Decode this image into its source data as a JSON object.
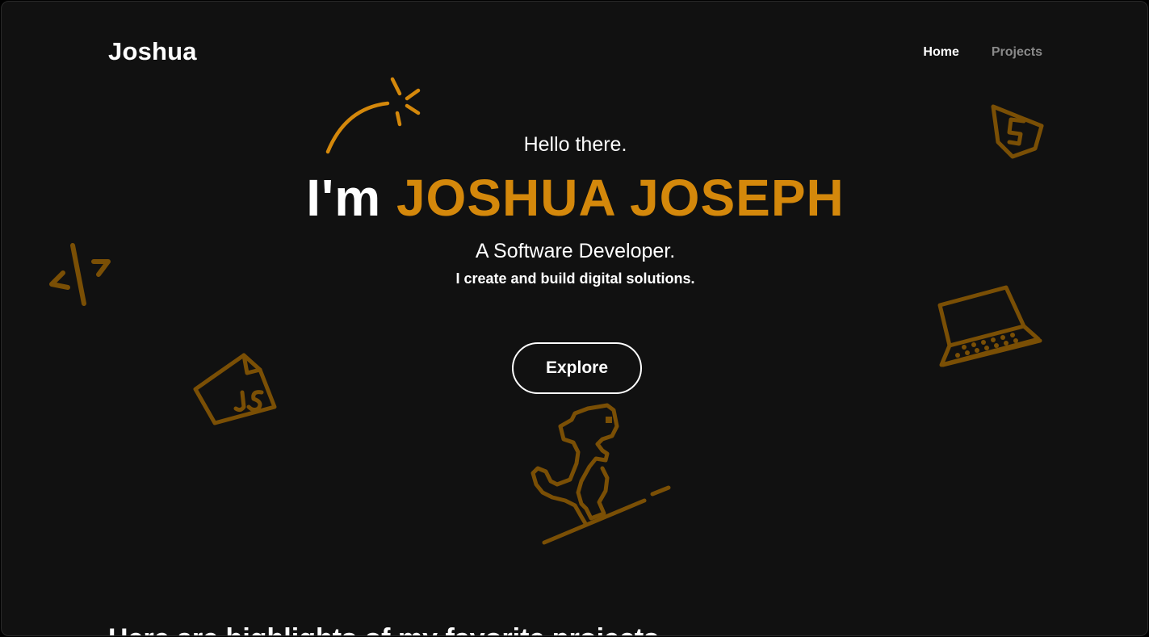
{
  "brand": {
    "name": "Joshua"
  },
  "nav": {
    "items": [
      {
        "label": "Home"
      },
      {
        "label": "Projects"
      }
    ]
  },
  "hero": {
    "greeting": "Hello there.",
    "intro": "I'm",
    "name": "JOSHUA JOSEPH",
    "role": "A Software Developer.",
    "tagline": "I create and build digital solutions.",
    "cta": "Explore"
  },
  "next_section": {
    "heading": "Here are highlights of my favorite projects"
  },
  "colors": {
    "accent": "#d4880b",
    "doodle": "#7a4f05",
    "background": "#111111"
  },
  "decorations": [
    "comet-icon",
    "code-tag-icon",
    "javascript-file-icon",
    "html5-icon",
    "laptop-icon",
    "dinosaur-icon"
  ]
}
